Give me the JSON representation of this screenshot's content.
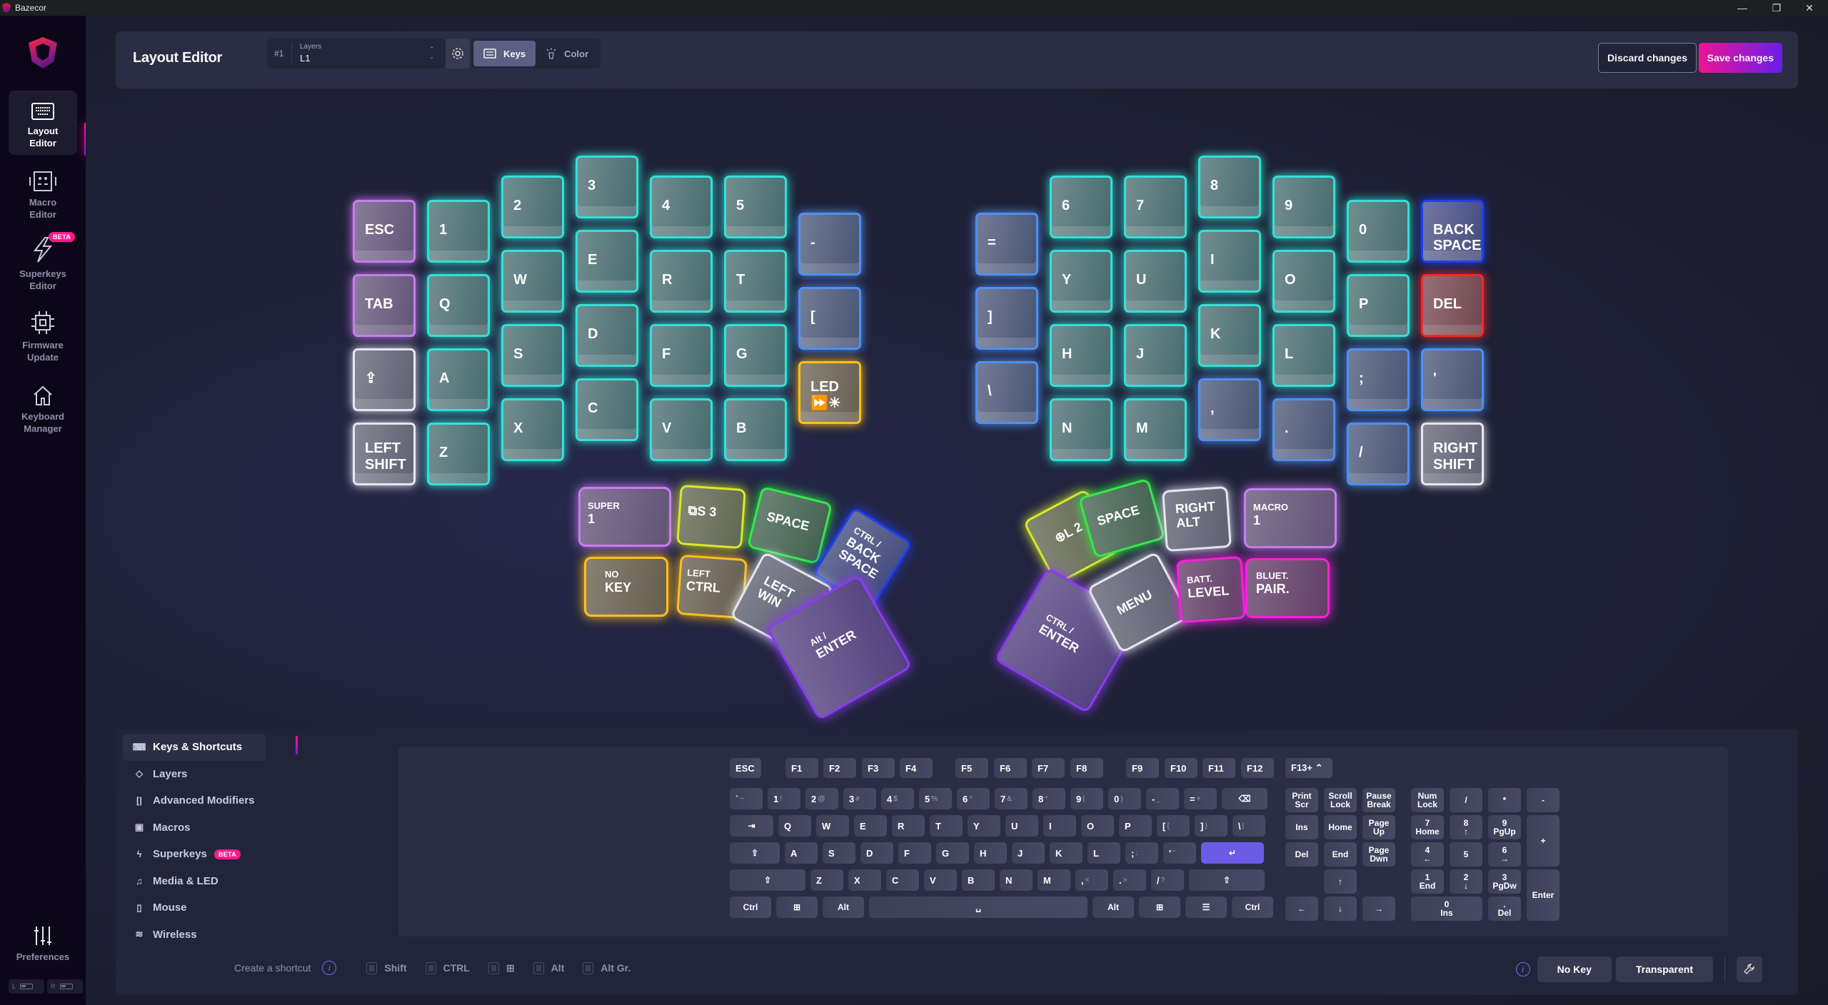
{
  "window": {
    "title": "Bazecor",
    "controls": [
      "minimize",
      "restore",
      "close"
    ]
  },
  "sidebar": {
    "items": [
      {
        "label": "Layout\nEditor",
        "icon": "keyboard-icon",
        "active": true
      },
      {
        "label": "Macro\nEditor",
        "icon": "robot-icon",
        "active": false
      },
      {
        "label": "Superkeys\nEditor",
        "icon": "lightning-icon",
        "active": false,
        "badge": "BETA"
      },
      {
        "label": "Firmware\nUpdate",
        "icon": "chip-icon",
        "active": false
      },
      {
        "label": "Keyboard\nManager",
        "icon": "home-icon",
        "active": false
      }
    ],
    "preferences": "Preferences",
    "battery": {
      "left": "L",
      "right": "R"
    }
  },
  "topbar": {
    "title": "Layout Editor",
    "layer_number": "#1",
    "layer_caption": "Layers",
    "layer_value": "L1",
    "mode_keys": "Keys",
    "mode_color": "Color",
    "active_mode": "Keys",
    "discard": "Discard changes",
    "save": "Save changes"
  },
  "colors": {
    "accent_pink": "#ff1a8c",
    "accent_purple": "#6b1ff0",
    "teal": "#33e0d6",
    "blue": "#4f8ff0",
    "lilac": "#c77cf0",
    "white": "#e6e6f0",
    "yellow": "#ffbf1a",
    "lime": "#d8e830",
    "green": "#35e84a",
    "red": "#f02a2a",
    "magenta": "#f024d8",
    "violet": "#8a3cf0",
    "deepblue": "#2040f0"
  },
  "left_half": [
    {
      "label": "ESC",
      "color": "lilac"
    },
    {
      "label": "1",
      "color": "teal"
    },
    {
      "label": "2",
      "color": "teal"
    },
    {
      "label": "3",
      "color": "teal"
    },
    {
      "label": "4",
      "color": "teal"
    },
    {
      "label": "5",
      "color": "teal"
    },
    {
      "label": "-",
      "color": "blue"
    },
    {
      "label": "TAB",
      "color": "lilac"
    },
    {
      "label": "Q",
      "color": "teal"
    },
    {
      "label": "W",
      "color": "teal"
    },
    {
      "label": "E",
      "color": "teal"
    },
    {
      "label": "R",
      "color": "teal"
    },
    {
      "label": "T",
      "color": "teal"
    },
    {
      "label": "[",
      "color": "blue"
    },
    {
      "label": "⇪",
      "color": "white"
    },
    {
      "label": "A",
      "color": "teal"
    },
    {
      "label": "S",
      "color": "teal"
    },
    {
      "label": "D",
      "color": "teal"
    },
    {
      "label": "F",
      "color": "teal"
    },
    {
      "label": "G",
      "color": "teal"
    },
    {
      "label": "LED",
      "sub": "⏩☀",
      "color": "yellow"
    },
    {
      "label": "LEFT",
      "sub": "SHIFT",
      "color": "white"
    },
    {
      "label": "Z",
      "color": "teal"
    },
    {
      "label": "X",
      "color": "teal"
    },
    {
      "label": "C",
      "color": "teal"
    },
    {
      "label": "V",
      "color": "teal"
    },
    {
      "label": "B",
      "color": "teal"
    }
  ],
  "left_thumbs": [
    {
      "top": "SUPER",
      "main": "1",
      "color": "lilac"
    },
    {
      "top": "",
      "main": "⧉S 3",
      "color": "lime"
    },
    {
      "top": "",
      "main": "SPACE",
      "color": "green"
    },
    {
      "top": "CTRL /",
      "main": "BACK\nSPACE",
      "color": "deepblue"
    },
    {
      "top": "NO",
      "main": "KEY",
      "color": "yellow"
    },
    {
      "top": "LEFT",
      "main": "CTRL",
      "color": "yellow"
    },
    {
      "top": "",
      "main": "LEFT\nWIN",
      "color": "white"
    },
    {
      "top": "Alt /",
      "main": "ENTER",
      "color": "violet"
    }
  ],
  "right_half": [
    {
      "label": "6",
      "color": "teal"
    },
    {
      "label": "7",
      "color": "teal"
    },
    {
      "label": "8",
      "color": "teal"
    },
    {
      "label": "9",
      "color": "teal"
    },
    {
      "label": "0",
      "color": "teal"
    },
    {
      "label": "BACK\nSPACE",
      "color": "deepblue"
    },
    {
      "label": "=",
      "color": "blue"
    },
    {
      "label": "Y",
      "color": "teal"
    },
    {
      "label": "U",
      "color": "teal"
    },
    {
      "label": "I",
      "color": "teal"
    },
    {
      "label": "O",
      "color": "teal"
    },
    {
      "label": "P",
      "color": "teal"
    },
    {
      "label": "DEL",
      "color": "red"
    },
    {
      "label": "]",
      "color": "blue"
    },
    {
      "label": "H",
      "color": "teal"
    },
    {
      "label": "J",
      "color": "teal"
    },
    {
      "label": "K",
      "color": "teal"
    },
    {
      "label": "L",
      "color": "teal"
    },
    {
      "label": ";",
      "color": "blue"
    },
    {
      "label": "'",
      "color": "blue"
    },
    {
      "label": "\\",
      "color": "blue"
    },
    {
      "label": "N",
      "color": "teal"
    },
    {
      "label": "M",
      "color": "teal"
    },
    {
      "label": ",",
      "color": "blue"
    },
    {
      "label": ".",
      "color": "blue"
    },
    {
      "label": "/",
      "color": "blue"
    },
    {
      "label": "RIGHT",
      "sub": "SHIFT",
      "color": "white"
    }
  ],
  "right_thumbs": [
    {
      "top": "",
      "main": "⊕L 2",
      "color": "lime"
    },
    {
      "top": "",
      "main": "SPACE",
      "color": "green"
    },
    {
      "top": "",
      "main": "RIGHT\nALT",
      "color": "white"
    },
    {
      "top": "MACRO",
      "main": "1",
      "color": "lilac"
    },
    {
      "top": "CTRL /",
      "main": "ENTER",
      "color": "violet"
    },
    {
      "top": "",
      "main": "MENU",
      "color": "white"
    },
    {
      "top": "BATT.",
      "main": "LEVEL",
      "color": "magenta"
    },
    {
      "top": "BLUET.",
      "main": "PAIR.",
      "color": "magenta"
    }
  ],
  "categories": [
    {
      "label": "Keys & Shortcuts",
      "icon": "keyboard-icon",
      "active": true
    },
    {
      "label": "Layers",
      "icon": "layers-icon"
    },
    {
      "label": "Advanced Modifiers",
      "icon": "modifiers-icon"
    },
    {
      "label": "Macros",
      "icon": "robot-icon"
    },
    {
      "label": "Superkeys",
      "icon": "lightning-icon",
      "badge": "BETA"
    },
    {
      "label": "Media & LED",
      "icon": "music-icon"
    },
    {
      "label": "Mouse",
      "icon": "mouse-icon"
    },
    {
      "label": "Wireless",
      "icon": "wifi-icon"
    }
  ],
  "virtual_keyboard": {
    "frow": [
      "ESC",
      "F1",
      "F2",
      "F3",
      "F4",
      "F5",
      "F6",
      "F7",
      "F8",
      "F9",
      "F10",
      "F11",
      "F12"
    ],
    "f13_selector": "F13+",
    "row1": [
      [
        "`",
        "~"
      ],
      [
        "1",
        "!"
      ],
      [
        "2",
        "@"
      ],
      [
        "3",
        "#"
      ],
      [
        "4",
        "$"
      ],
      [
        "5",
        "%"
      ],
      [
        "6",
        "^"
      ],
      [
        "7",
        "&"
      ],
      [
        "8",
        "*"
      ],
      [
        "9",
        "("
      ],
      [
        "0",
        ")"
      ],
      [
        "-",
        "_"
      ],
      [
        "=",
        "+"
      ],
      [
        "⌫",
        ""
      ]
    ],
    "row2": [
      [
        "⇥",
        ""
      ],
      [
        "Q",
        ""
      ],
      [
        "W",
        ""
      ],
      [
        "E",
        ""
      ],
      [
        "R",
        ""
      ],
      [
        "T",
        ""
      ],
      [
        "Y",
        ""
      ],
      [
        "U",
        ""
      ],
      [
        "I",
        ""
      ],
      [
        "O",
        ""
      ],
      [
        "P",
        ""
      ],
      [
        "[",
        "{"
      ],
      [
        "]",
        "}"
      ],
      [
        "\\",
        "|"
      ]
    ],
    "row3": [
      [
        "⇪",
        ""
      ],
      [
        "A",
        ""
      ],
      [
        "S",
        ""
      ],
      [
        "D",
        ""
      ],
      [
        "F",
        ""
      ],
      [
        "G",
        ""
      ],
      [
        "H",
        ""
      ],
      [
        "J",
        ""
      ],
      [
        "K",
        ""
      ],
      [
        "L",
        ""
      ],
      [
        ";",
        ":"
      ],
      [
        "'",
        "\""
      ],
      [
        "↵",
        ""
      ]
    ],
    "row4": [
      [
        "⇧",
        ""
      ],
      [
        "Z",
        ""
      ],
      [
        "X",
        ""
      ],
      [
        "C",
        ""
      ],
      [
        "V",
        ""
      ],
      [
        "B",
        ""
      ],
      [
        "N",
        ""
      ],
      [
        "M",
        ""
      ],
      [
        ",",
        "<"
      ],
      [
        ".",
        ">"
      ],
      [
        "/",
        "?"
      ],
      [
        "⇧",
        ""
      ]
    ],
    "row5": [
      "Ctrl",
      "⊞",
      "Alt",
      "␣",
      "Alt",
      "⊞",
      "☰",
      "Ctrl"
    ],
    "nav": [
      "Print\nScr",
      "Scroll\nLock",
      "Pause\nBreak",
      "Ins",
      "Home",
      "Page\nUp",
      "Del",
      "End",
      "Page\nDwn",
      "↑",
      "←",
      "↓",
      "→"
    ],
    "numpad": [
      "Num\nLock",
      "/",
      "*",
      "-",
      "7\nHome",
      "8\n↑",
      "9\nPgUp",
      "+",
      "4\n←",
      "5",
      "6\n→",
      "1\nEnd",
      "2\n↓",
      "3\nPgDw",
      "Enter",
      "0\nIns",
      ".\nDel"
    ]
  },
  "shortcut": {
    "label": "Create a shortcut",
    "modifiers": [
      {
        "label": "Shift",
        "checked": false
      },
      {
        "label": "CTRL",
        "checked": false
      },
      {
        "label": "⊞",
        "checked": false
      },
      {
        "label": "Alt",
        "checked": false
      },
      {
        "label": "Alt Gr.",
        "checked": false
      }
    ]
  },
  "actions": {
    "no_key": "No Key",
    "transparent": "Transparent"
  }
}
